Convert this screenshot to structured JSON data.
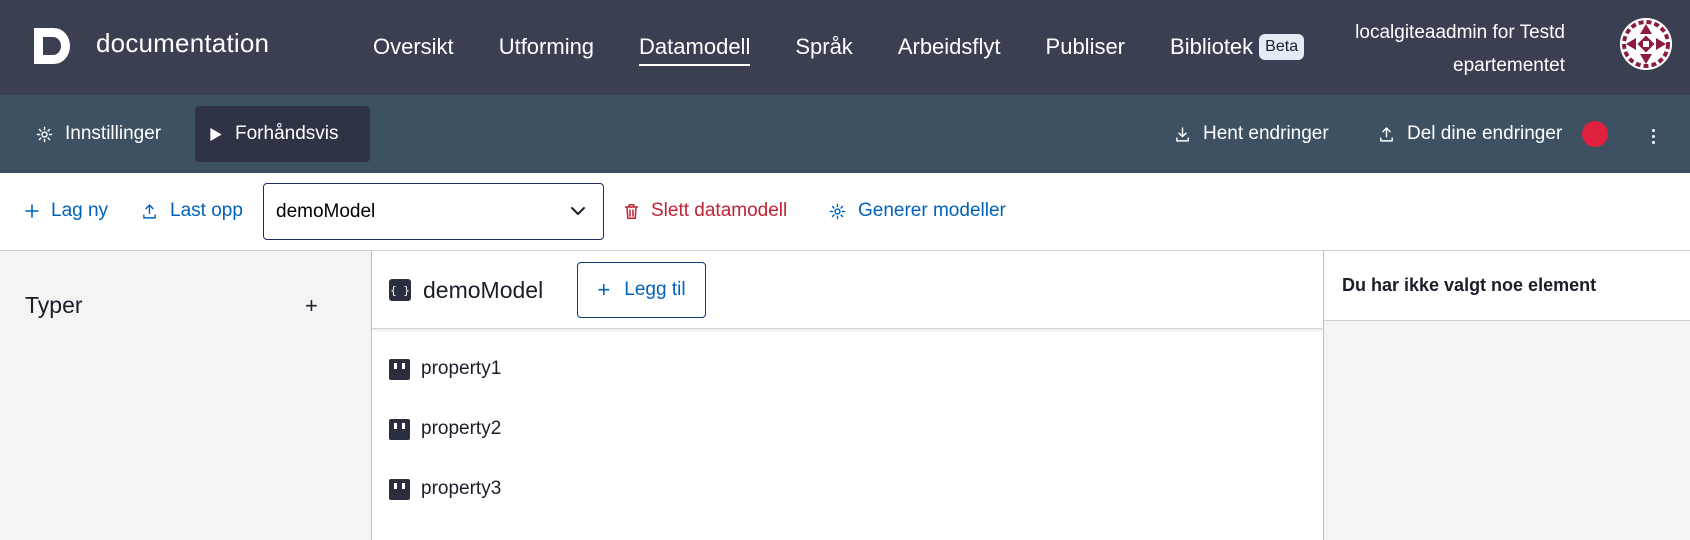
{
  "header": {
    "app_title": "documentation",
    "nav": [
      {
        "label": "Oversikt"
      },
      {
        "label": "Utforming"
      },
      {
        "label": "Datamodell"
      },
      {
        "label": "Språk"
      },
      {
        "label": "Arbeidsflyt"
      },
      {
        "label": "Publiser"
      },
      {
        "label": "Bibliotek",
        "badge": "Beta"
      }
    ],
    "active_nav": "Datamodell",
    "user_line1": "localgiteaadmin for Testd",
    "user_line2": "epartementet"
  },
  "subbar": {
    "settings_label": "Innstillinger",
    "preview_label": "Forhåndsvis",
    "fetch_label": "Hent endringer",
    "share_label": "Del dine endringer",
    "share_indicator_color": "#e0203f"
  },
  "toolbar": {
    "create_label": "Lag ny",
    "upload_label": "Last opp",
    "model_select_value": "demoModel",
    "delete_label": "Slett datamodell",
    "generate_label": "Generer modeller"
  },
  "types_panel": {
    "title": "Typer",
    "add_symbol": "+"
  },
  "model_panel": {
    "model_icon_text": "{ }",
    "model_name": "demoModel",
    "add_label": "Legg til",
    "properties": [
      {
        "name": "property1"
      },
      {
        "name": "property2"
      },
      {
        "name": "property3"
      }
    ]
  },
  "details_panel": {
    "empty_title": "Du har ikke valgt noe element"
  },
  "colors": {
    "header_bg": "#3b3f52",
    "subheader_bg": "#3e5162",
    "link_blue": "#0062ba",
    "danger_red": "#c22136",
    "panel_bg": "#f4f4f4"
  }
}
